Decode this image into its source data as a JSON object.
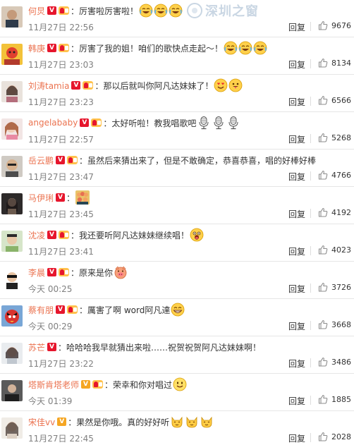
{
  "reply_label": "回复",
  "colors": {
    "name": "#eb7350",
    "verified": "#e6162d",
    "verified_gold": "#f5a623",
    "time": "#808080"
  },
  "watermark": "深圳之窗",
  "comments": [
    {
      "name": "何炅",
      "badge": "V",
      "level": true,
      "text": "厉害啦厉害啦！",
      "emojis": [
        "crying-laugh-emoji",
        "crying-laugh-emoji",
        "crying-laugh-emoji"
      ],
      "time": "11月27日 22:56",
      "likes": "9676"
    },
    {
      "name": "韩庚",
      "badge": "V",
      "level": true,
      "text": "厉害了我的姐！咱们的歌快点走起～！",
      "emojis": [
        "crying-laugh-emoji",
        "crying-laugh-emoji",
        "crying-laugh-emoji"
      ],
      "time": "11月27日 23:03",
      "likes": "8134"
    },
    {
      "name": "刘涛tamia",
      "badge": "V",
      "level": true,
      "text": "那以后就叫你阿凡达妹妹了！",
      "emojis": [
        "heart-eyes-emoji",
        "tongue-emoji"
      ],
      "time": "11月27日 23:23",
      "likes": "6566"
    },
    {
      "name": "angelababy",
      "badge": "V",
      "level": true,
      "text": "太好听啦！教我唱歌吧",
      "emojis": [
        "microphone-emoji",
        "microphone-emoji",
        "microphone-emoji"
      ],
      "time": "11月27日 22:57",
      "likes": "5268"
    },
    {
      "name": "岳云鹏",
      "badge": "V",
      "level": true,
      "text": "虽然后来猜出来了，但是不敢确定，恭喜恭喜，唱的好棒好棒",
      "emojis": [],
      "time": "11月27日 23:47",
      "likes": "4766"
    },
    {
      "name": "马伊琍",
      "badge": "V",
      "level": false,
      "text": "",
      "emojis": [
        "crowd-emoji"
      ],
      "time": "11月27日 23:45",
      "likes": "4192"
    },
    {
      "name": "沈凌",
      "badge": "V",
      "level": true,
      "text": "我还要听阿凡达妹妹继续唱！",
      "emojis": [
        "shocked-emoji"
      ],
      "time": "11月27日 23:41",
      "likes": "4023"
    },
    {
      "name": "李晨",
      "badge": "V",
      "level": true,
      "text": "原来是你",
      "emojis": [
        "pig-emoji"
      ],
      "time": "今天 00:25",
      "likes": "3726"
    },
    {
      "name": "蔡有朋",
      "badge": "V",
      "level": true,
      "text": "厲害了啊 word阿凡達",
      "emojis": [
        "grin-emoji"
      ],
      "time": "今天 00:29",
      "likes": "3668"
    },
    {
      "name": "苏芒",
      "badge": "V",
      "level": false,
      "text": "哈哈哈我早就猜出来啦……祝贺祝贺阿凡达妹妹啊！",
      "emojis": [],
      "time": "11月27日 23:22",
      "likes": "3486"
    },
    {
      "name": "塔斯肯塔老师",
      "badge": "V",
      "gold": true,
      "level": true,
      "text": "荣幸和你对唱过",
      "emojis": [
        "smile-emoji"
      ],
      "time": "今天 01:39",
      "likes": "1885"
    },
    {
      "name": "宋佳vv",
      "badge": "V",
      "gold": true,
      "level": false,
      "text": "果然是你哦。真的好好听",
      "emojis": [
        "cat-emoji",
        "cat-emoji",
        "cat-emoji"
      ],
      "time": "11月27日 22:45",
      "likes": "2028"
    }
  ]
}
